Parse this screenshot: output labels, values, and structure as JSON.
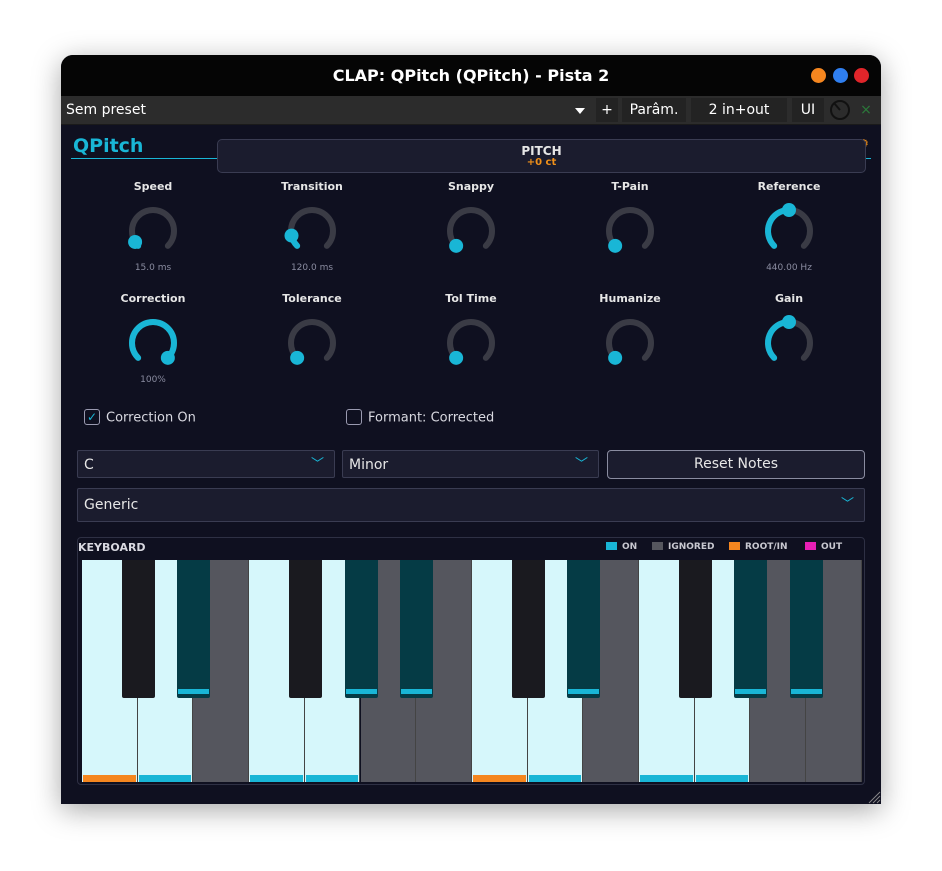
{
  "window": {
    "title": "CLAP: QPitch (QPitch) - Pista 2",
    "traffic_colors": [
      "#f5861f",
      "#2f7ff0",
      "#e0252a"
    ]
  },
  "toolbar": {
    "preset": "Sem preset",
    "add_label": "+",
    "params_label": "Parâm.",
    "io_label": "2 in+out",
    "ui_label": "UI",
    "close_label": "×"
  },
  "plugin": {
    "name": "QPitch",
    "pitch": {
      "label": "PITCH",
      "value": "+0 ct"
    },
    "knobs_row1": [
      {
        "label": "Speed",
        "value": "15.0 ms",
        "level": 0.05
      },
      {
        "label": "Transition",
        "value": "120.0 ms",
        "level": 0.12
      },
      {
        "label": "Snappy",
        "value": "",
        "level": 0.0
      },
      {
        "label": "T-Pain",
        "value": "",
        "level": 0.0
      },
      {
        "label": "Reference",
        "value": "440.00 Hz",
        "level": 0.5
      }
    ],
    "knobs_row2": [
      {
        "label": "Correction",
        "value": "100%",
        "level": 1.0
      },
      {
        "label": "Tolerance",
        "value": "",
        "level": 0.0
      },
      {
        "label": "Tol Time",
        "value": "",
        "level": 0.0
      },
      {
        "label": "Humanize",
        "value": "",
        "level": 0.0
      },
      {
        "label": "Gain",
        "value": "",
        "level": 0.5
      }
    ],
    "correction_on": {
      "label": "Correction On",
      "checked": true
    },
    "formant": {
      "label": "Formant: Corrected",
      "checked": false
    },
    "key_select": "C",
    "scale_select": "Minor",
    "reset_label": "Reset Notes",
    "preset_select": "Generic",
    "keyboard": {
      "title": "KEYBOARD",
      "legend": [
        {
          "label": "ON",
          "color": "#19b6d6"
        },
        {
          "label": "IGNORED",
          "color": "#55565e"
        },
        {
          "label": "ROOT/IN",
          "color": "#f5861f"
        },
        {
          "label": "OUT",
          "color": "#e81fb5"
        }
      ],
      "white_keys": [
        {
          "state": "on",
          "marker": "root"
        },
        {
          "state": "on",
          "marker": "on"
        },
        {
          "state": "ignored",
          "marker": ""
        },
        {
          "state": "on",
          "marker": "on"
        },
        {
          "state": "on",
          "marker": "on"
        },
        {
          "state": "ignored",
          "marker": ""
        },
        {
          "state": "ignored",
          "marker": ""
        },
        {
          "state": "on",
          "marker": "root"
        },
        {
          "state": "on",
          "marker": "on"
        },
        {
          "state": "ignored",
          "marker": ""
        },
        {
          "state": "on",
          "marker": "on"
        },
        {
          "state": "on",
          "marker": "on"
        },
        {
          "state": "ignored",
          "marker": ""
        },
        {
          "state": "ignored",
          "marker": ""
        }
      ],
      "black_keys": [
        {
          "state": "ignored"
        },
        {
          "state": "on"
        },
        {
          "state": "ignored"
        },
        {
          "state": "on"
        },
        {
          "state": "on"
        },
        {
          "state": "ignored"
        },
        {
          "state": "on"
        },
        {
          "state": "ignored"
        },
        {
          "state": "on"
        },
        {
          "state": "on"
        }
      ]
    }
  },
  "colors": {
    "accent": "#19b6d6",
    "root": "#f5861f",
    "out": "#e81fb5"
  }
}
